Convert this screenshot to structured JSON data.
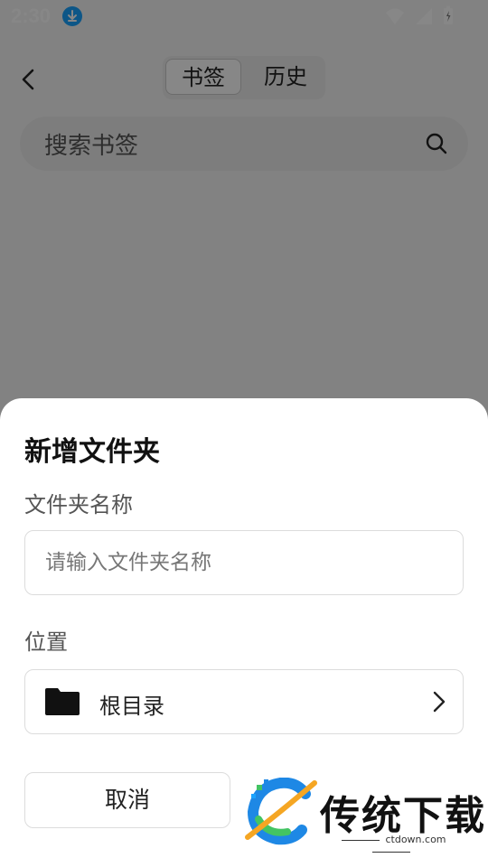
{
  "status_bar": {
    "time": "2:30"
  },
  "header": {
    "tabs": [
      {
        "label": "书签",
        "active": true
      },
      {
        "label": "历史",
        "active": false
      }
    ]
  },
  "search": {
    "placeholder": "搜索书签"
  },
  "dialog": {
    "title": "新增文件夹",
    "name_label": "文件夹名称",
    "name_placeholder": "请输入文件夹名称",
    "location_label": "位置",
    "location_value": "根目录",
    "cancel_label": "取消"
  },
  "watermark": {
    "brand": "传统下载",
    "site": "ctdown.com"
  },
  "colors": {
    "accent": "#1aa3ff",
    "scrim": "rgba(0,0,0,0.47)"
  }
}
